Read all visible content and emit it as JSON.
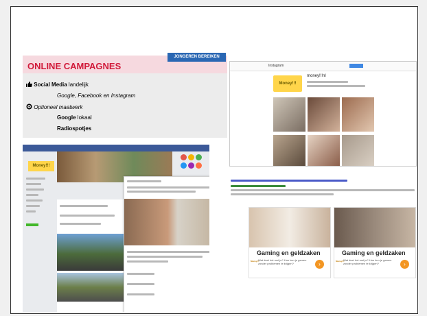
{
  "campaign": {
    "title": "ONLINE CAMPAGNES",
    "tag": "JONGEREN BEREIKEN",
    "line1_bold": "Social Media",
    "line1_rest": " landelijk",
    "line2": "Google, Facebook en Instagram",
    "line3": "Optioneel maatwerk",
    "line4_bold": "Google",
    "line4_rest": " lokaal",
    "line5": "Radiospotjes"
  },
  "instagram": {
    "logo": "Instagram",
    "profile_logo": "Money!!!",
    "username": "money!!!nl"
  },
  "google_ad": {
    "cards": [
      {
        "title": "Gaming en geldzaken",
        "desc": "Wat doet het met je? Hoe kun je gamen zonder problemen te krijgen?",
        "logo": "Money!!!",
        "btn": "›"
      },
      {
        "title": "Gaming en geldzaken",
        "desc": "Wat doet het met je? Hoe kun je gamen zonder problemen te krijgen?",
        "logo": "Money!!!",
        "btn": "›"
      }
    ]
  },
  "facebook": {
    "logo": "Money!!!"
  },
  "colors": {
    "accent_red": "#d11a3a",
    "tag_blue": "#2a67b3",
    "facebook_blue": "#3b5998",
    "brand_yellow": "#ffd54a",
    "cta_orange": "#f39623"
  }
}
